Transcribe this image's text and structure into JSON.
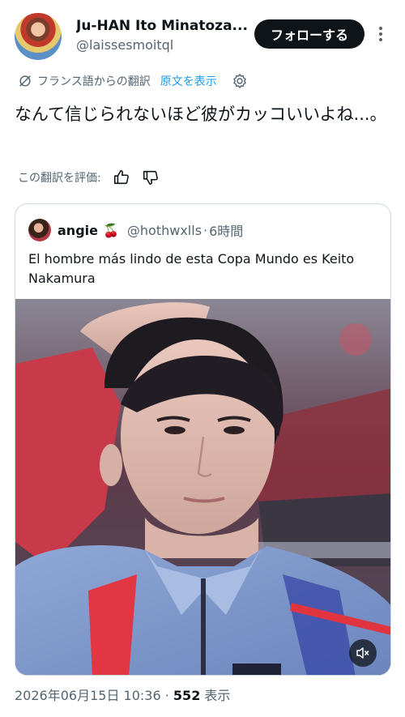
{
  "author": {
    "display_name": "Ju-HAN Ito Minatoza...",
    "handle": "@laissesmoitql",
    "follow_label": "フォローする"
  },
  "translation": {
    "from_label": "フランス語からの翻訳",
    "show_original_label": "原文を表示",
    "icons": [
      "translate-icon",
      "gear-icon"
    ]
  },
  "tweet": {
    "text": "なんて信じられないほど彼がカッコいいよね...。"
  },
  "rating": {
    "label": "この翻訳を評価:",
    "icons": [
      "thumbs-up-icon",
      "thumbs-down-icon"
    ]
  },
  "quote": {
    "name": "angie",
    "emoji": "🍒",
    "handle": "@hothwxlls",
    "separator": "·",
    "time": "6時間",
    "text": "El hombre más lindo de esta Copa Mundo es Keito Nakamura"
  },
  "media": {
    "kind": "video",
    "mute_icon": "muted-speaker-icon"
  },
  "footer": {
    "timestamp": "2026年06月15日 10:36",
    "separator": "·",
    "views_count": "552",
    "views_label": "表示"
  },
  "colors": {
    "accent": "#1d9bf0",
    "text": "#0f1419",
    "muted": "#536471",
    "border": "#cfd9de"
  }
}
